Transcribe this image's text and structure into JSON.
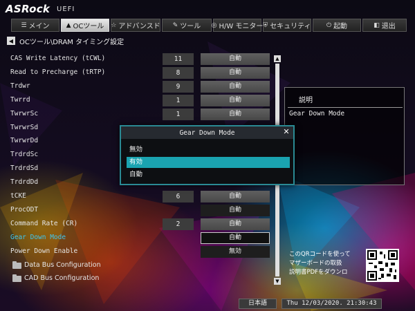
{
  "header": {
    "logo": "ASRock",
    "logo_sub": "UEFI"
  },
  "tabs": [
    {
      "label": "メイン",
      "icon": "list-icon",
      "glyph": "☰",
      "active": false
    },
    {
      "label": "OCツール",
      "icon": "rocket-icon",
      "glyph": "▲",
      "active": true
    },
    {
      "label": "アドバンスド",
      "icon": "star-icon",
      "glyph": "☆",
      "active": false
    },
    {
      "label": "ツール",
      "icon": "wrench-icon",
      "glyph": "✎",
      "active": false
    },
    {
      "label": "H/W モニター",
      "icon": "monitor-icon",
      "glyph": "◎",
      "active": false
    },
    {
      "label": "セキュリティ",
      "icon": "shield-icon",
      "glyph": "⛨",
      "active": false
    },
    {
      "label": "起動",
      "icon": "power-icon",
      "glyph": "⏻",
      "active": false
    },
    {
      "label": "退出",
      "icon": "exit-icon",
      "glyph": "◧",
      "active": false
    }
  ],
  "breadcrumb": "OCツール\\DRAM タイミング設定",
  "settings": [
    {
      "label": "CAS Write Latency (tCWL)",
      "value": "11",
      "option": "自動"
    },
    {
      "label": "Read to Precharge (tRTP)",
      "value": "8",
      "option": "自動"
    },
    {
      "label": "Trdwr",
      "value": "9",
      "option": "自動"
    },
    {
      "label": "Twrrd",
      "value": "1",
      "option": "自動"
    },
    {
      "label": "TwrwrSc",
      "value": "1",
      "option": "自動"
    },
    {
      "label": "TwrwrSd",
      "value": "",
      "option": ""
    },
    {
      "label": "TwrwrDd",
      "value": "",
      "option": ""
    },
    {
      "label": "TrdrdSc",
      "value": "",
      "option": ""
    },
    {
      "label": "TrdrdSd",
      "value": "",
      "option": ""
    },
    {
      "label": "TrdrdDd",
      "value": "",
      "option": ""
    },
    {
      "label": "tCKE",
      "value": "6",
      "option": "自動"
    },
    {
      "label": "ProcODT",
      "value": "",
      "option": "自動"
    },
    {
      "label": "Command Rate (CR)",
      "value": "2",
      "option": "自動"
    },
    {
      "label": "Gear Down Mode",
      "value": "",
      "option": "自動"
    },
    {
      "label": "Power Down Enable",
      "value": "",
      "option": "無効"
    },
    {
      "label": "Data Bus Configuration",
      "value": "",
      "option": ""
    },
    {
      "label": "CAD Bus Configuration",
      "value": "",
      "option": ""
    }
  ],
  "selected_setting": "Gear Down Mode",
  "description": {
    "title": "説明",
    "text": "Gear Down Mode"
  },
  "popup": {
    "title": "Gear Down Mode",
    "options": [
      "無効",
      "有効",
      "自動"
    ],
    "selected_index": 1
  },
  "scrollbar": {
    "thumb_fraction": 1.0
  },
  "qr_text": [
    "このQRコードを使って",
    "マザーボードの取扱",
    "説明書PDFをダウンロ"
  ],
  "footer": {
    "language": "日本語",
    "datetime": "Thu 12/03/2020. 21:30:43"
  }
}
